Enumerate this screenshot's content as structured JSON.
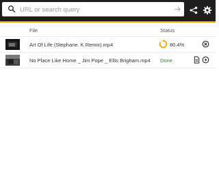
{
  "search": {
    "placeholder": "URL or search query",
    "value": ""
  },
  "toolbar": {
    "icons": [
      "search-icon",
      "arrow-right-icon",
      "share-icon",
      "gear-icon"
    ]
  },
  "table": {
    "headers": {
      "file": "File",
      "status": "Status"
    },
    "rows": [
      {
        "file": "Art Of Life (Stephane. K Remix).mp4",
        "status_percent": "80.4%",
        "progress": 0.804,
        "actions": [
          "cancel-icon"
        ]
      },
      {
        "file": "No Place Like Home _ Jim Pope _ Ellis Brigham.mp4",
        "status": "Done",
        "actions": [
          "document-icon",
          "play-icon"
        ]
      }
    ]
  },
  "colors": {
    "topbar": "#1f1f1f",
    "accent": "#f0a400",
    "done": "#2e7d32"
  }
}
